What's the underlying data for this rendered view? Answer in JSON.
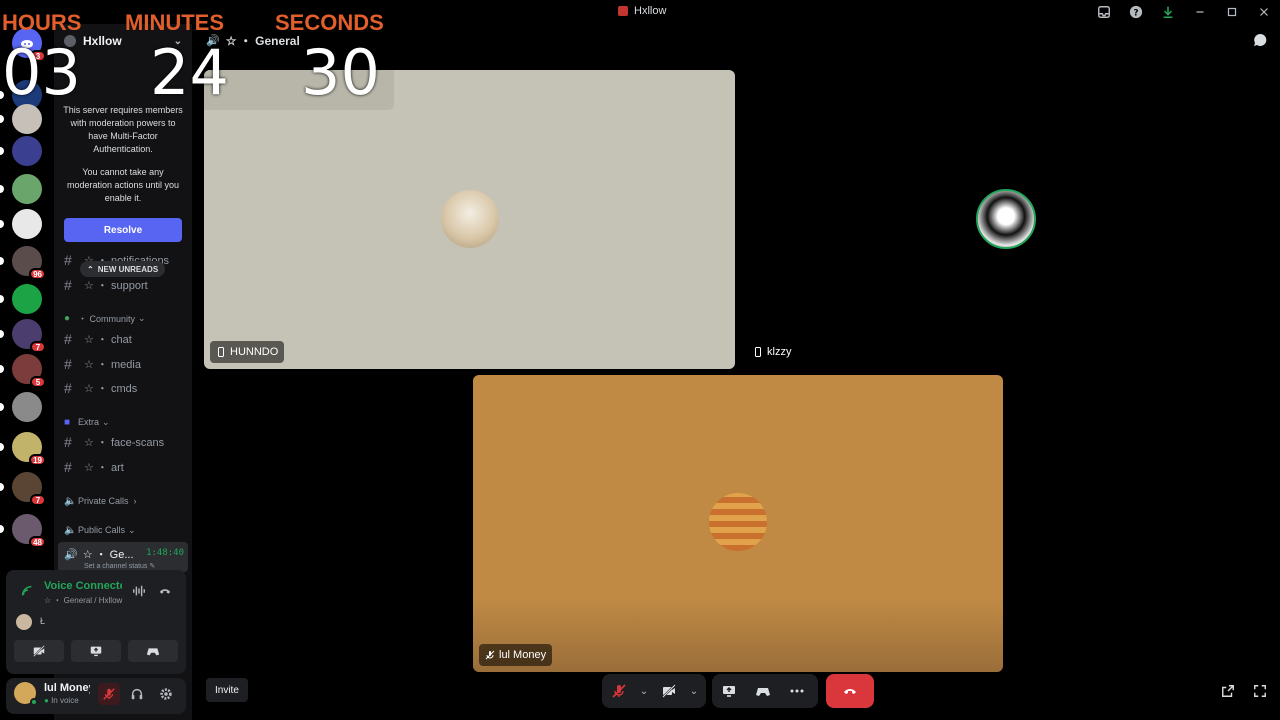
{
  "window": {
    "title": "Hxllow"
  },
  "timer": {
    "hours_label": "HOURS",
    "minutes_label": "MINUTES",
    "seconds_label": "SECONDS",
    "hours": "03",
    "minutes": "24",
    "seconds": "30"
  },
  "server_rail": {
    "items": [
      {
        "color": "#1d3a7a",
        "badge": ""
      },
      {
        "color": "#c7c0b8",
        "badge": ""
      },
      {
        "color": "#3a3f8f",
        "badge": ""
      },
      {
        "color": "#6aa56b",
        "badge": ""
      },
      {
        "color": "#e8e8e8",
        "badge": ""
      },
      {
        "color": "#5b4c4c",
        "badge": "96"
      },
      {
        "color": "#1ca346",
        "badge": ""
      },
      {
        "color": "#4b3d6e",
        "badge": "7"
      },
      {
        "color": "#7d3c3c",
        "badge": "5"
      },
      {
        "color": "#8a8a8a",
        "badge": ""
      },
      {
        "color": "#c2b36a",
        "badge": "19"
      },
      {
        "color": "#5a4535",
        "badge": "7"
      },
      {
        "color": "#6b5a6e",
        "badge": "48"
      }
    ]
  },
  "sidebar": {
    "guild_name": "Hxllow",
    "mfa_notice_1": "This server requires members with moderation powers to have Multi-Factor Authentication.",
    "mfa_notice_2": "You cannot take any moderation actions until you enable it.",
    "resolve_label": "Resolve",
    "new_unreads": "NEW UNREADS",
    "channels": {
      "notifications": "☆ ・ notifications",
      "support": "☆ ・ support",
      "chat": "☆ ・ chat",
      "media": "☆ ・ media",
      "cmds": "☆ ・ cmds",
      "face_scans": "☆ ・ face-scans",
      "art": "☆ ・ art"
    },
    "categories": {
      "community": "・ Community",
      "extra": "Extra",
      "private_calls": "Private Calls",
      "public_calls": "Public Calls"
    },
    "active_voice": {
      "name": "☆ ・ Ge...",
      "time": "1:48:40",
      "status": "Set a channel status"
    }
  },
  "voice_panel": {
    "title": "Voice Connected",
    "subtitle": "☆ ・ General / Hxllow",
    "member_name": "Ł"
  },
  "user_panel": {
    "name": "lul Money",
    "status": "In voice"
  },
  "stage": {
    "channel_name": "☆ ・ General",
    "tiles": [
      {
        "name": "HUNNDO",
        "bg": "#c5c3b6"
      },
      {
        "name": "klzzy",
        "bg": "#000000"
      },
      {
        "name": "lul Money",
        "bg": "#c08a44"
      }
    ],
    "invite_label": "Invite"
  },
  "colors": {
    "accent": "#5865f2",
    "voice_green": "#23a55a",
    "danger": "#da373c",
    "timer_label": "#e25f2b"
  }
}
